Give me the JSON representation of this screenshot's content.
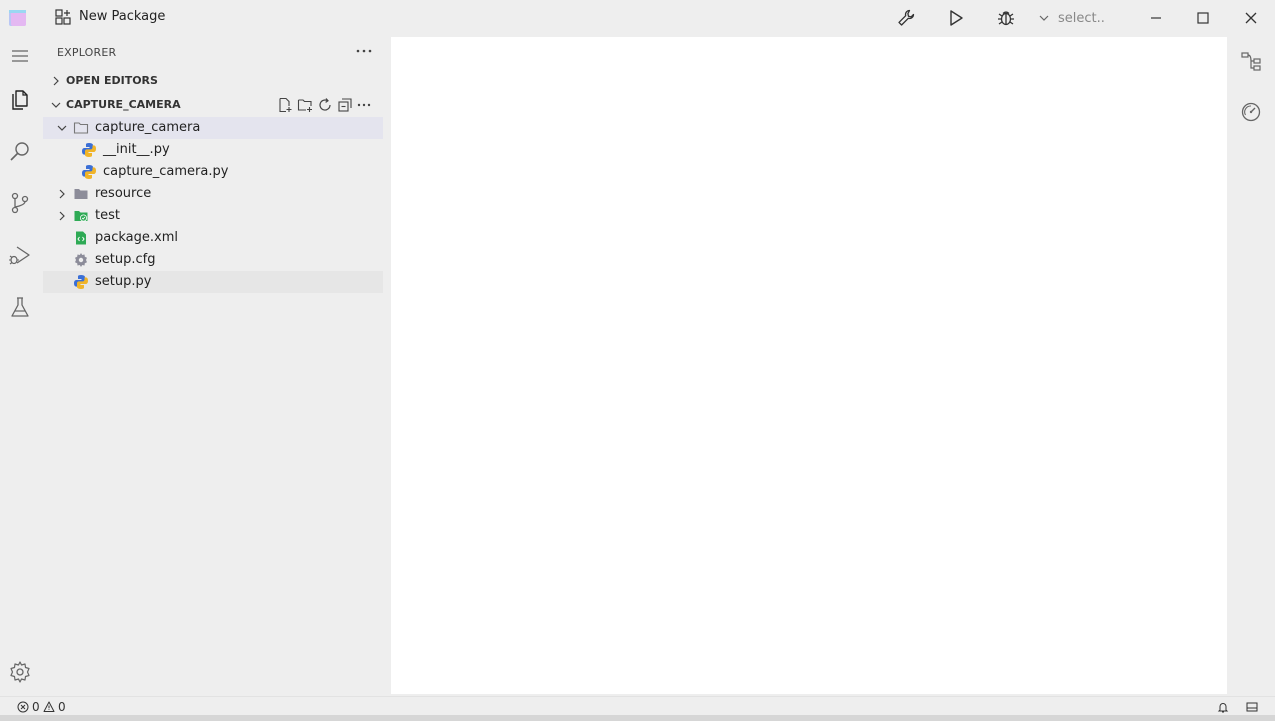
{
  "window": {
    "title": "New Package",
    "select_placeholder": "select.."
  },
  "sidebar": {
    "header": "EXPLORER",
    "sections": {
      "open_editors": "OPEN EDITORS",
      "project": "CAPTURE_CAMERA"
    },
    "tree": [
      {
        "name": "capture_camera",
        "type": "folder-open"
      },
      {
        "name": "__init__.py",
        "type": "python"
      },
      {
        "name": "capture_camera.py",
        "type": "python"
      },
      {
        "name": "resource",
        "type": "folder"
      },
      {
        "name": "test",
        "type": "folder-test"
      },
      {
        "name": "package.xml",
        "type": "xml"
      },
      {
        "name": "setup.cfg",
        "type": "gear"
      },
      {
        "name": "setup.py",
        "type": "python"
      }
    ]
  },
  "status": {
    "errors": "0",
    "warnings": "0"
  },
  "colors": {
    "accent_selected": "#e4e4ee",
    "python_blue": "#3b6fd6",
    "python_yellow": "#f0b429",
    "xml_green": "#2eaa55",
    "test_green": "#2eaa55",
    "folder_gray": "#8c8c99"
  }
}
